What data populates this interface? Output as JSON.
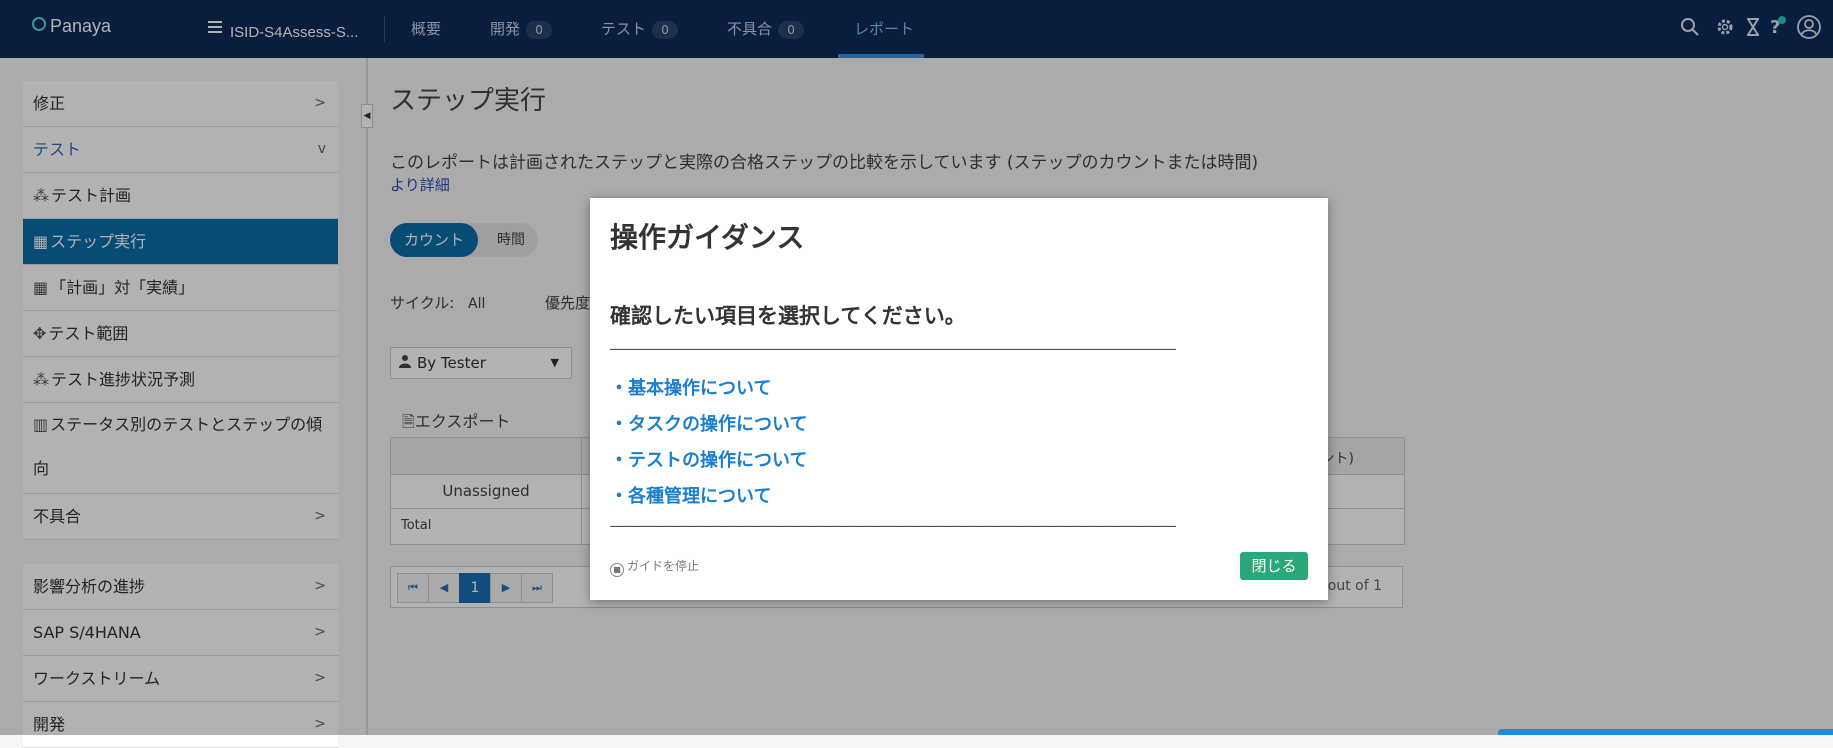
{
  "header": {
    "logo": "Panaya",
    "project": "ISID-S4Assess-S...",
    "nav": [
      {
        "label": "概要"
      },
      {
        "label": "開発",
        "count": "0"
      },
      {
        "label": "テスト",
        "count": "0"
      },
      {
        "label": "不具合",
        "count": "0"
      },
      {
        "label": "レポート"
      }
    ]
  },
  "sidebar": {
    "items": [
      {
        "label": "修正",
        "chevron": ">"
      },
      {
        "label": "テスト",
        "chevron": "v"
      },
      {
        "label": "テスト計画"
      },
      {
        "label": "ステップ実行"
      },
      {
        "label": "「計画」対「実績」"
      },
      {
        "label": "テスト範囲"
      },
      {
        "label": "テスト進捗状況予測"
      },
      {
        "label": "ステータス別のテストとステップの傾向"
      },
      {
        "label": "不具合",
        "chevron": ">"
      }
    ],
    "items2": [
      {
        "label": "影響分析の進捗",
        "chevron": ">"
      },
      {
        "label": "SAP S/4HANA",
        "chevron": ">"
      },
      {
        "label": "ワークストリーム",
        "chevron": ">"
      },
      {
        "label": "開発",
        "chevron": ">"
      }
    ]
  },
  "main": {
    "title": "ステップ実行",
    "description": "このレポートは計画されたステップと実際の合格ステップの比較を示しています (ステップのカウントまたは時間)",
    "more_link": "より詳細",
    "toggle": {
      "on": "カウント",
      "off": "時間"
    },
    "cycle_label": "サイクル:",
    "cycle_value": "All",
    "priority_label": "優先度",
    "group_by": "By Tester",
    "export": "エクスポート",
    "table": {
      "header_right": "ント)",
      "row1": "Unassigned",
      "row2": "Total"
    },
    "pager": {
      "current": "1",
      "right_text": "out of 1"
    }
  },
  "modal": {
    "title": "操作ガイダンス",
    "subtitle": "確認したい項目を選択してください。",
    "rule": "――――――――――――――――――――――――――――――――――――――――",
    "links": [
      "・基本操作について",
      "・タスクの操作について",
      "・テストの操作について",
      "・各種管理について"
    ],
    "stop_label": "ガイドを停止",
    "close_label": "閉じる"
  }
}
